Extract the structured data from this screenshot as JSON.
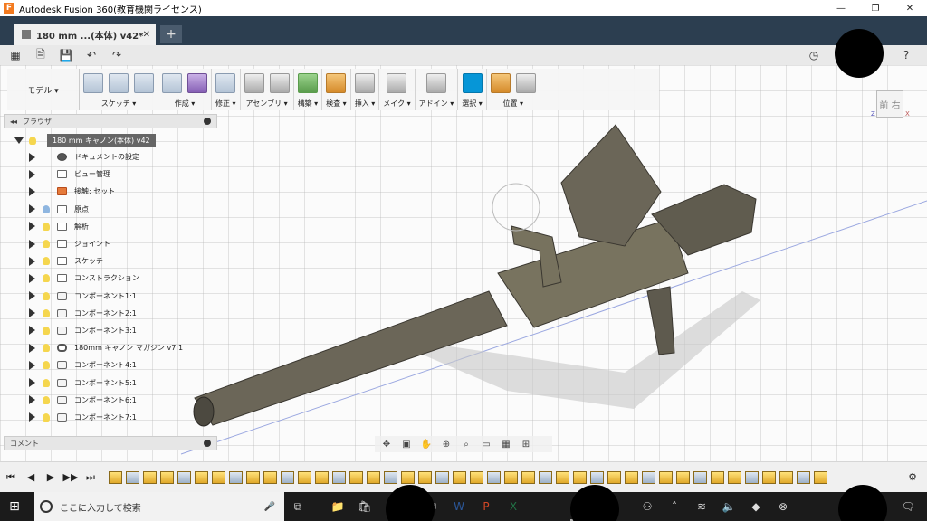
{
  "window": {
    "title": "Autodesk Fusion 360(教育機関ライセンス)",
    "controls": [
      "—",
      "❐",
      "✕"
    ]
  },
  "tab": {
    "name": "180 mm ...(本体) v42*",
    "close": "✕",
    "new": "+"
  },
  "toolbar": {
    "workspace": "モデル ▾",
    "groups": [
      {
        "label": "スケッチ ▾",
        "icons": [
          "sketch-create-icon",
          "spline-icon",
          "rectangle-icon"
        ]
      },
      {
        "label": "作成 ▾",
        "icons": [
          "extrude-icon",
          "form-icon"
        ]
      },
      {
        "label": "修正 ▾",
        "icons": [
          "press-pull-icon"
        ]
      },
      {
        "label": "アセンブリ ▾",
        "icons": [
          "new-component-icon",
          "joint-icon"
        ]
      },
      {
        "label": "構築 ▾",
        "icons": [
          "plane-icon"
        ]
      },
      {
        "label": "検査 ▾",
        "icons": [
          "measure-icon"
        ]
      },
      {
        "label": "挿入 ▾",
        "icons": [
          "insert-image-icon"
        ]
      },
      {
        "label": "メイク ▾",
        "icons": [
          "make-icon"
        ]
      },
      {
        "label": "アドイン ▾",
        "icons": [
          "scripts-icon"
        ]
      },
      {
        "label": "選択 ▾",
        "icons": [
          "select-icon"
        ]
      },
      {
        "label": "位置 ▾",
        "icons": [
          "position-icon",
          "capture-icon"
        ]
      }
    ]
  },
  "viewcube": {
    "face": "前 右",
    "axis_z": "Z",
    "axis_x": "X"
  },
  "browser": {
    "header": "ブラウザ",
    "root": "180 mm キャノン(本体) v42",
    "items": [
      {
        "label": "ドキュメントの設定",
        "icon": "gear"
      },
      {
        "label": "ビュー管理",
        "icon": "folder"
      },
      {
        "label": "接触: セット",
        "icon": "joint"
      },
      {
        "label": "原点",
        "icon": "folder",
        "bulb": "off"
      },
      {
        "label": "解析",
        "icon": "folder"
      },
      {
        "label": "ジョイント",
        "icon": "folder"
      },
      {
        "label": "スケッチ",
        "icon": "folder"
      },
      {
        "label": "コンストラクション",
        "icon": "folder"
      },
      {
        "label": "コンポーネント1:1",
        "icon": "comp"
      },
      {
        "label": "コンポーネント2:1",
        "icon": "comp"
      },
      {
        "label": "コンポーネント3:1",
        "icon": "comp"
      },
      {
        "label": "180mm キャノン マガジン v7:1",
        "icon": "link"
      },
      {
        "label": "コンポーネント4:1",
        "icon": "comp"
      },
      {
        "label": "コンポーネント5:1",
        "icon": "comp"
      },
      {
        "label": "コンポーネント6:1",
        "icon": "comp"
      },
      {
        "label": "コンポーネント7:1",
        "icon": "comp"
      }
    ]
  },
  "comment": {
    "label": "コメント"
  },
  "navbar": {
    "icons": [
      "orbit-icon",
      "look-at-icon",
      "pan-icon",
      "zoom-icon",
      "fit-icon",
      "display-settings-icon",
      "grid-icon",
      "viewports-icon"
    ]
  },
  "timeline": {
    "controls": [
      "⏮",
      "◀",
      "▶",
      "▶▶",
      "⏭"
    ],
    "feature_count": 42
  },
  "taskbar": {
    "search_placeholder": "ここに入力して検索",
    "apps": [
      "task-view-icon",
      "explorer-icon",
      "store-icon",
      "mail-icon",
      "word-icon",
      "powerpoint-icon",
      "excel-icon",
      "fusion-icon"
    ],
    "tray": [
      "people-icon",
      "chevron-up-icon",
      "wifi-icon",
      "network-icon",
      "onedrive-icon",
      "volume-icon",
      "dropbox-icon",
      "error-icon"
    ]
  }
}
